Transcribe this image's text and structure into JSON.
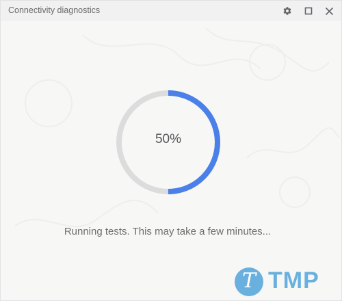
{
  "window": {
    "title": "Connectivity diagnostics",
    "controls": [
      {
        "icon": "gear-icon",
        "label": "Settings"
      },
      {
        "icon": "maximize-icon",
        "label": "Maximize"
      },
      {
        "icon": "close-icon",
        "label": "Close"
      }
    ]
  },
  "progress": {
    "value": 0.5,
    "label": "50%",
    "track_color": "#dcdcdc",
    "fill_color": "#4a80e8"
  },
  "status": {
    "message": "Running tests. This may take a few minutes..."
  },
  "watermark": {
    "letter": "T",
    "text": "TMP",
    "color": "#6ab0df"
  }
}
